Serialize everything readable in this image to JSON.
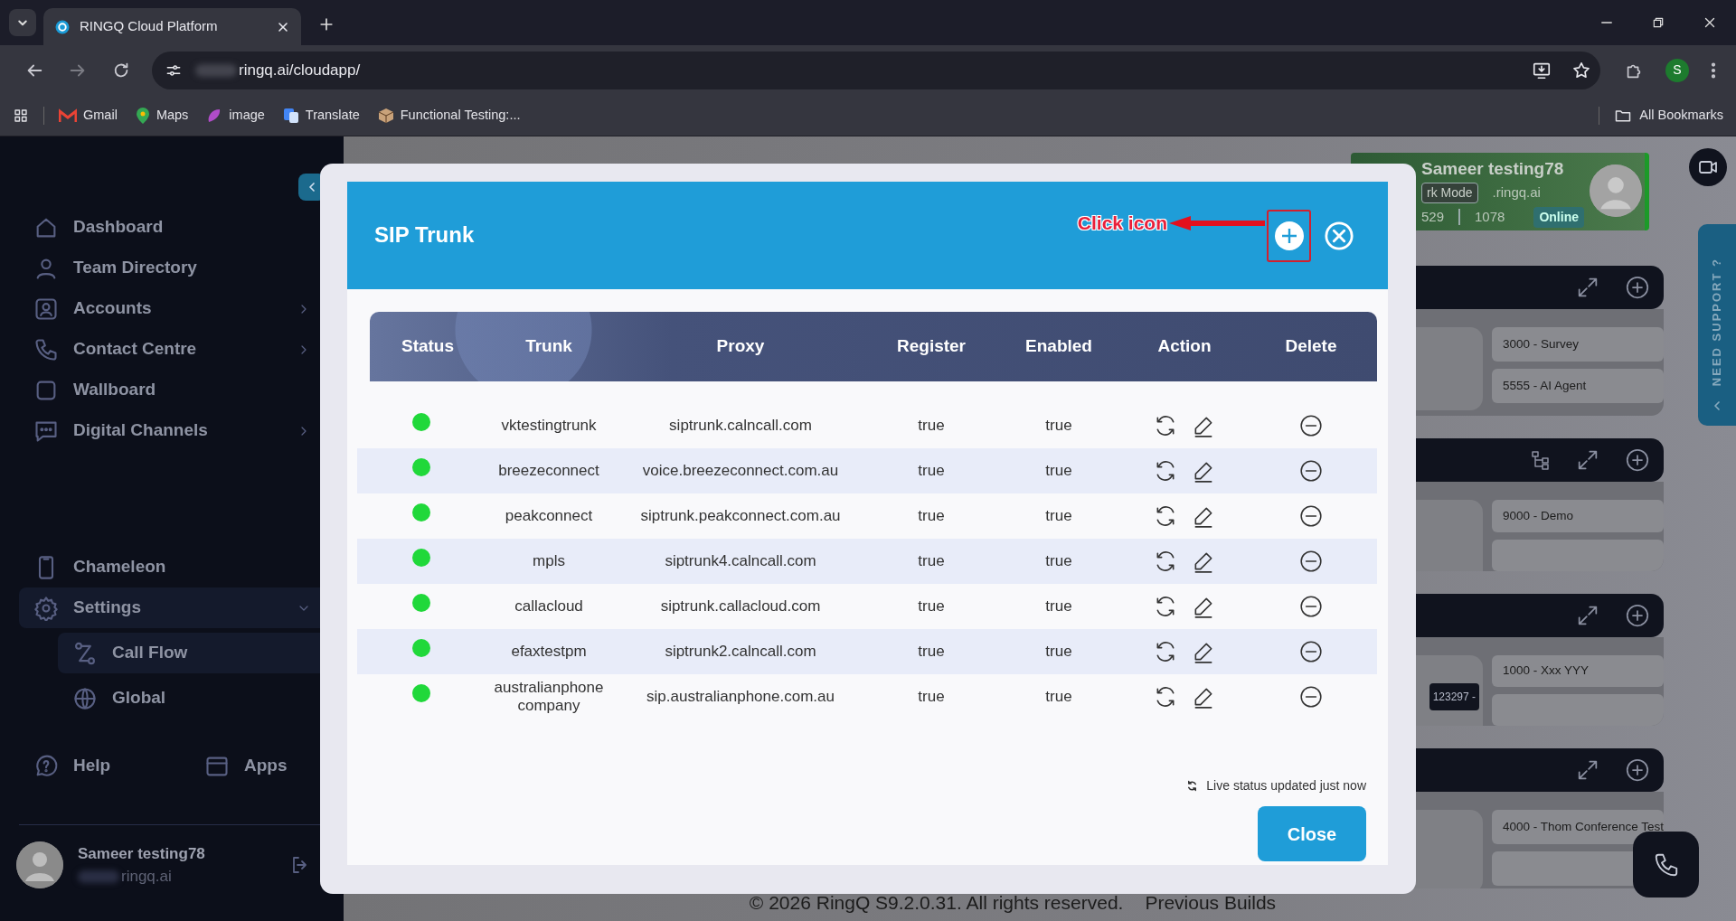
{
  "browser": {
    "tab_title": "RINGQ Cloud Platform",
    "url": "ringq.ai/cloudapp/",
    "profile_initial": "S",
    "bookmarks": [
      "Gmail",
      "Maps",
      "image",
      "Translate",
      "Functional Testing:..."
    ],
    "all_bookmarks": "All Bookmarks"
  },
  "sidebar": {
    "main_items": [
      {
        "label": "Dashboard",
        "kind": "link",
        "selected": false
      },
      {
        "label": "Team Directory",
        "kind": "link",
        "selected": false
      },
      {
        "label": "Accounts",
        "kind": "group",
        "expanded": false,
        "selected": false
      },
      {
        "label": "Contact Centre",
        "kind": "group",
        "expanded": false,
        "selected": false
      },
      {
        "label": "Wallboard",
        "kind": "link",
        "selected": false
      },
      {
        "label": "Digital Channels",
        "kind": "group",
        "expanded": false,
        "selected": false
      }
    ],
    "lower_items": [
      {
        "label": "Chameleon",
        "kind": "link",
        "selected": false
      },
      {
        "label": "Settings",
        "kind": "group",
        "expanded": true,
        "selected": true,
        "children": [
          {
            "label": "Call Flow",
            "selected": true
          },
          {
            "label": "Global",
            "selected": false
          }
        ]
      }
    ],
    "bottom_links": [
      "Help",
      "Apps"
    ],
    "user": {
      "name": "Sameer testing78",
      "email": "ringq.ai"
    }
  },
  "background": {
    "profile": {
      "name": "Sameer testing78",
      "mode": "rk Mode",
      "email": ".ringq.ai",
      "extension": "529",
      "number": "1078",
      "status": "Online"
    },
    "panels": [
      {
        "tree_button": false,
        "more_below": false,
        "items": [
          "3000 - Survey",
          "5555 - AI Agent"
        ]
      },
      {
        "tree_button": true,
        "more_below": true,
        "items": [
          "9000 - Demo"
        ]
      },
      {
        "tree_button": false,
        "more_below": true,
        "chip": "123297 -",
        "items": [
          "1000 - Xxx YYY"
        ]
      },
      {
        "tree_button": false,
        "more_below": true,
        "items": [
          "4000 - Thom Conference Test"
        ]
      }
    ],
    "support_tab": "NEED SUPPORT ?",
    "footer": {
      "text": "© 2026 RingQ S9.2.0.31. All rights reserved.",
      "link": "Previous Builds"
    }
  },
  "modal": {
    "title": "SIP Trunk",
    "annotation": "Click icon",
    "columns": [
      "Status",
      "Trunk",
      "Proxy",
      "Register",
      "Enabled",
      "Action",
      "Delete"
    ],
    "rows": [
      {
        "color": "#20d83a",
        "trunk": "vktestingtrunk",
        "proxy": "siptrunk.calncall.com",
        "register": "true",
        "enabled": "true"
      },
      {
        "color": "#20d83a",
        "trunk": "breezeconnect",
        "proxy": "voice.breezeconnect.com.au",
        "register": "true",
        "enabled": "true"
      },
      {
        "color": "#20d83a",
        "trunk": "peakconnect",
        "proxy": "siptrunk.peakconnect.com.au",
        "register": "true",
        "enabled": "true"
      },
      {
        "color": "#20d83a",
        "trunk": "mpls",
        "proxy": "siptrunk4.calncall.com",
        "register": "true",
        "enabled": "true"
      },
      {
        "color": "#20d83a",
        "trunk": "callacloud",
        "proxy": "siptrunk.callacloud.com",
        "register": "true",
        "enabled": "true"
      },
      {
        "color": "#20d83a",
        "trunk": "efaxtestpm",
        "proxy": "siptrunk2.calncall.com",
        "register": "true",
        "enabled": "true"
      },
      {
        "color": "#20d83a",
        "trunk": "australianphonecompany",
        "proxy": "sip.australianphone.com.au",
        "register": "true",
        "enabled": "true"
      }
    ],
    "live_status": "Live status updated just now",
    "close_label": "Close"
  }
}
